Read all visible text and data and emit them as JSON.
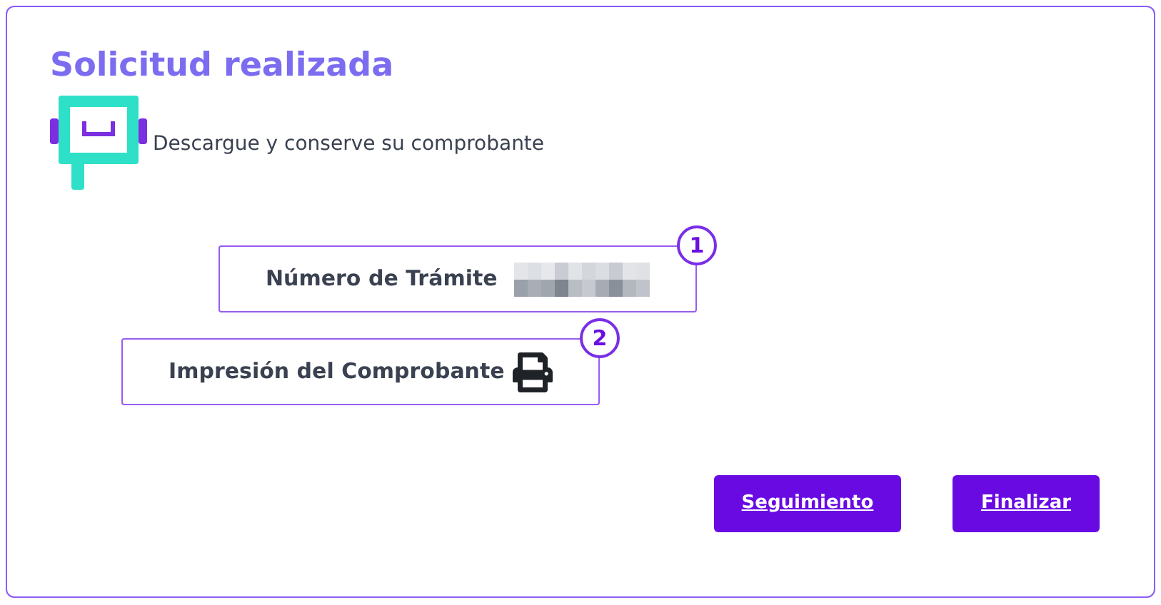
{
  "title": "Solicitud realizada",
  "subtitle": "Descargue y conserve su comprobante",
  "items": [
    {
      "badge": "1",
      "label": "Número de Trámite",
      "kind": "redacted"
    },
    {
      "badge": "2",
      "label": "Impresión del Comprobante",
      "kind": "print"
    }
  ],
  "buttons": [
    "Seguimiento",
    "Finalizar"
  ]
}
